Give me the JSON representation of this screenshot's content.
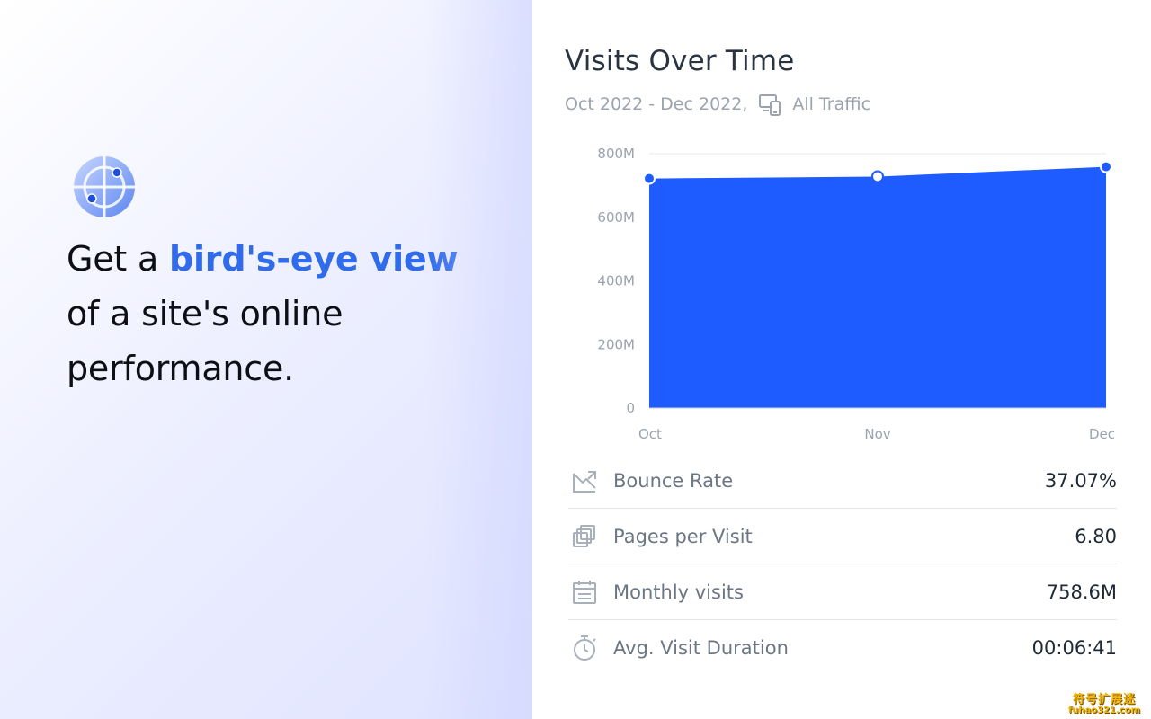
{
  "hero": {
    "line1_prefix": "Get a ",
    "line1_accent": "bird's-eye view",
    "line2": "of a site's online",
    "line3": "performance."
  },
  "card": {
    "title": "Visits Over Time",
    "date_range": "Oct 2022 - Dec 2022,",
    "traffic_filter": "All Traffic"
  },
  "chart_data": {
    "type": "area",
    "categories": [
      "Oct",
      "Nov",
      "Dec"
    ],
    "series": [
      {
        "values": [
          722,
          728,
          758.6
        ]
      }
    ],
    "ylim": [
      0,
      800
    ],
    "yticks": [
      "0",
      "200M",
      "400M",
      "600M",
      "800M"
    ],
    "ytick_values": [
      0,
      200,
      400,
      600,
      800
    ],
    "grid": true,
    "color": "#1f5cff"
  },
  "metrics": [
    {
      "icon": "bounce-rate-icon",
      "label": "Bounce Rate",
      "value": "37.07%"
    },
    {
      "icon": "pages-icon",
      "label": "Pages per Visit",
      "value": "6.80"
    },
    {
      "icon": "calendar-icon",
      "label": "Monthly visits",
      "value": "758.6M"
    },
    {
      "icon": "stopwatch-icon",
      "label": "Avg. Visit Duration",
      "value": "00:06:41"
    }
  ],
  "watermark": {
    "cn": "符号扩展迷",
    "url": "fuhao321.com"
  },
  "colors": {
    "accent": "#2f6bea",
    "chart_fill": "#1f5cff",
    "text_dark": "#0e0f14"
  }
}
